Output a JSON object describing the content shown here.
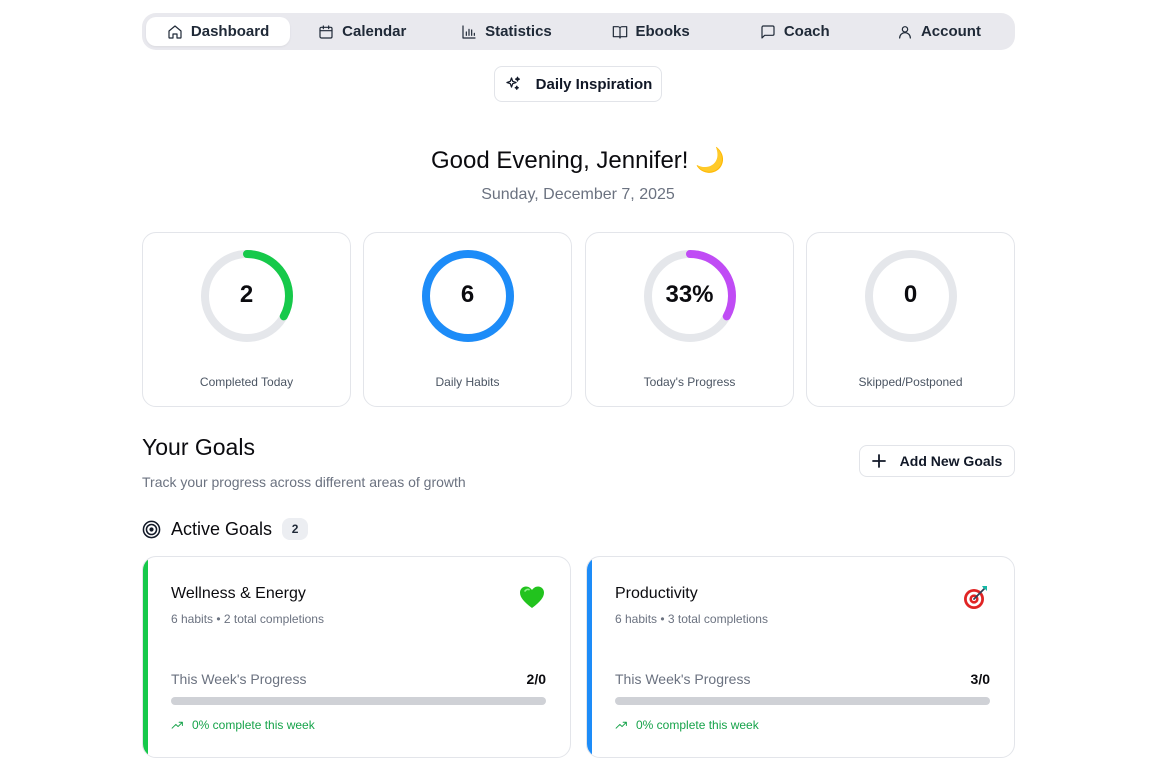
{
  "nav": {
    "tabs": [
      {
        "label": "Dashboard",
        "icon": "home-icon",
        "active": true
      },
      {
        "label": "Calendar",
        "icon": "calendar-icon",
        "active": false
      },
      {
        "label": "Statistics",
        "icon": "bar-chart-icon",
        "active": false
      },
      {
        "label": "Ebooks",
        "icon": "book-open-icon",
        "active": false
      },
      {
        "label": "Coach",
        "icon": "message-square-icon",
        "active": false
      },
      {
        "label": "Account",
        "icon": "user-icon",
        "active": false
      }
    ]
  },
  "inspiration": {
    "label": "Daily Inspiration",
    "icon": "sparkles-icon"
  },
  "greeting": {
    "text": "Good Evening, Jennifer! 🌙",
    "date": "Sunday, December 7, 2025"
  },
  "stats": [
    {
      "value": "2",
      "label": "Completed Today",
      "progress": 0.33,
      "color": "#16c94a"
    },
    {
      "value": "6",
      "label": "Daily Habits",
      "progress": 1.0,
      "color": "#1d8cf8"
    },
    {
      "value": "33%",
      "label": "Today's Progress",
      "progress": 0.33,
      "color": "#c04cf5"
    },
    {
      "value": "0",
      "label": "Skipped/Postponed",
      "progress": 0,
      "color": "#e5e7eb"
    }
  ],
  "goals": {
    "title": "Your Goals",
    "subtitle": "Track your progress across different areas of growth",
    "add_label": "Add New Goals",
    "active_label": "Active Goals",
    "active_count": "2",
    "cards": [
      {
        "name": "Wellness & Energy",
        "meta": "6 habits • 2 total completions",
        "emoji": "green-heart-icon",
        "week_label": "This Week's Progress",
        "week_value": "2/0",
        "week_progress": 0,
        "footer": "0% complete this week",
        "accent": "#16c94a"
      },
      {
        "name": "Productivity",
        "meta": "6 habits • 3 total completions",
        "emoji": "direct-hit-target-icon",
        "week_label": "This Week's Progress",
        "week_value": "3/0",
        "week_progress": 0,
        "footer": "0% complete this week",
        "accent": "#1d8cf8"
      }
    ]
  }
}
